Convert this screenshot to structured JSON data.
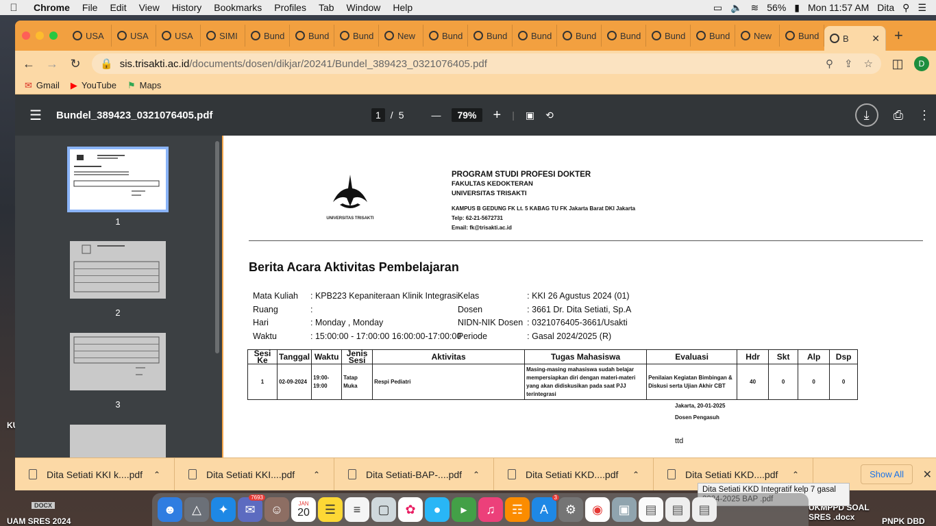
{
  "menubar": {
    "app": "Chrome",
    "items": [
      "File",
      "Edit",
      "View",
      "History",
      "Bookmarks",
      "Profiles",
      "Tab",
      "Window",
      "Help"
    ],
    "battery": "56%",
    "clock": "Mon 11:57 AM",
    "user": "Dita"
  },
  "tabs": [
    {
      "label": "USA"
    },
    {
      "label": "USA"
    },
    {
      "label": "USA"
    },
    {
      "label": "SIMI"
    },
    {
      "label": "Bund"
    },
    {
      "label": "Bund"
    },
    {
      "label": "Bund"
    },
    {
      "label": "New"
    },
    {
      "label": "Bund"
    },
    {
      "label": "Bund"
    },
    {
      "label": "Bund"
    },
    {
      "label": "Bund"
    },
    {
      "label": "Bund"
    },
    {
      "label": "Bund"
    },
    {
      "label": "Bund"
    },
    {
      "label": "New"
    },
    {
      "label": "Bund"
    }
  ],
  "active_tab": {
    "label": "B"
  },
  "address": {
    "host": "sis.trisakti.ac.id",
    "path": "/documents/dosen/dikjar/20241/Bundel_389423_0321076405.pdf"
  },
  "profile_initial": "D",
  "bookmarks": [
    "Gmail",
    "YouTube",
    "Maps"
  ],
  "pdf": {
    "filename": "Bundel_389423_0321076405.pdf",
    "current_page": "1",
    "separator": "/",
    "total_pages": "5",
    "zoom": "79%"
  },
  "thumbnails": [
    "1",
    "2",
    "3"
  ],
  "document": {
    "header": {
      "program": "PROGRAM STUDI PROFESI DOKTER",
      "faculty": "FAKULTAS KEDOKTERAN",
      "university": "UNIVERSITAS TRISAKTI",
      "address": "KAMPUS B GEDUNG FK Lt. 5 KABAG TU FK Jakarta Barat DKI Jakarta",
      "phone": "Telp: 62-21-5672731",
      "email": "Email: fk@trisakti.ac.id",
      "logo_caption": "UNIVERSITAS TRISAKTI"
    },
    "title": "Berita Acara Aktivitas Pembelajaran",
    "info_left": [
      {
        "label": "Mata Kuliah",
        "value": ": KPB223  Kepaniteraan Klinik Integrasi"
      },
      {
        "label": "Ruang",
        "value": ":"
      },
      {
        "label": "Hari",
        "value": ": Monday , Monday"
      },
      {
        "label": "Waktu",
        "value": ": 15:00:00 - 17:00:00 16:00:00-17:00:00"
      }
    ],
    "info_right": [
      {
        "label": "Kelas",
        "value": ": KKI 26 Agustus 2024 (01)"
      },
      {
        "label": "Dosen",
        "value": ": 3661 Dr. Dita Setiati, Sp.A"
      },
      {
        "label": "NIDN-NIK Dosen",
        "value": ": 0321076405-3661/Usakti"
      },
      {
        "label": "Periode",
        "value": ": Gasal 2024/2025 (R)"
      }
    ],
    "table": {
      "headers": [
        "Sesi Ke",
        "Tanggal",
        "Waktu",
        "Jenis Sesi",
        "Aktivitas",
        "Tugas Mahasiswa",
        "Evaluasi",
        "Hdr",
        "Skt",
        "Alp",
        "Dsp"
      ],
      "rows": [
        {
          "sesi": "1",
          "tanggal": "02-09-2024",
          "waktu": "19:00-19:00",
          "jenis": "Tatap Muka",
          "aktivitas": "Respi Pediatri",
          "tugas": "Masing-masing mahasiswa sudah belajar mempersiapkan diri dengan materi-materi yang akan didiskusikan pada saat PJJ terintegrasi",
          "evaluasi": "Penilaian Kegiatan Bimbingan & Diskusi serta Ujian Akhir CBT",
          "hdr": "40",
          "skt": "0",
          "alp": "0",
          "dsp": "0"
        }
      ]
    },
    "place_date": "Jakarta, 20-01-2025",
    "signer_role": "Dosen Pengasuh",
    "signature": "ttd"
  },
  "downloads": [
    "Dita Setiati KKI k....pdf",
    "Dita Setiati KKI....pdf",
    "Dita Setiati-BAP-....pdf",
    "Dita Setiati KKD....pdf",
    "Dita Setiati KKD....pdf"
  ],
  "show_all": "Show All",
  "tooltip": "Dita Setiati KKD Integratif  kelp 7 gasal 2024-2025 BAP  .pdf",
  "dock_badges": {
    "mail": "7693",
    "appstore": "3"
  },
  "calendar": {
    "month": "JAN",
    "day": "20"
  },
  "desktop": {
    "left_bottom": "UAM SRES  2024",
    "docx": "DOCX",
    "ku": "KU",
    "right1": "UKMPPD SOAL SRES .docx",
    "right2": "PNPK DBD"
  }
}
